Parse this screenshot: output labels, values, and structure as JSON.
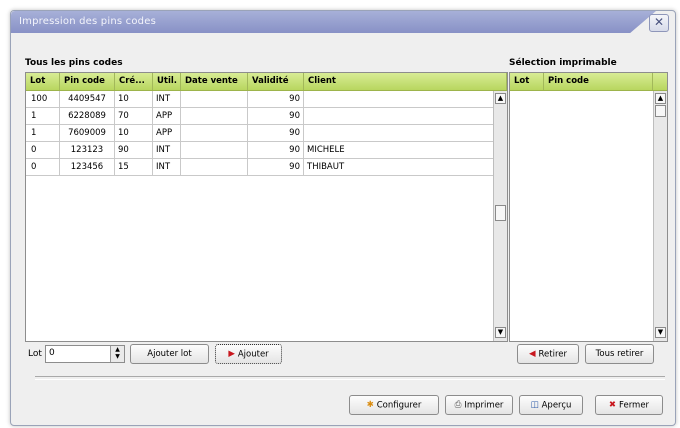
{
  "window": {
    "title": "Impression des pins codes",
    "close_glyph": "✕"
  },
  "left": {
    "label": "Tous les pins codes",
    "columns": [
      "Lot",
      "Pin code",
      "Cré...",
      "Util.",
      "Date vente",
      "Validité",
      "Client"
    ],
    "rows": [
      [
        "100",
        "4409547",
        "10",
        "INT",
        "",
        "90",
        ""
      ],
      [
        "1",
        "6228089",
        "70",
        "APP",
        "",
        "90",
        ""
      ],
      [
        "1",
        "7609009",
        "10",
        "APP",
        "",
        "90",
        ""
      ],
      [
        "0",
        "123123",
        "90",
        "INT",
        "",
        "90",
        "MICHELE"
      ],
      [
        "0",
        "123456",
        "15",
        "INT",
        "",
        "90",
        "THIBAUT"
      ]
    ]
  },
  "right": {
    "label": "Sélection imprimable",
    "columns": [
      "Lot",
      "Pin code"
    ]
  },
  "lot_control": {
    "label": "Lot",
    "value": "0"
  },
  "buttons": {
    "ajouter_lot": "Ajouter lot",
    "ajouter": "Ajouter",
    "retirer": "Retirer",
    "tous_retirer": "Tous retirer",
    "configurer": "Configurer",
    "imprimer": "Imprimer",
    "apercu": "Aperçu",
    "fermer": "Fermer"
  },
  "colors": {
    "header_green": "#c4de74",
    "title_blue": "#959dcc",
    "red_accent": "#c8171e"
  },
  "icons": [
    "close-icon",
    "arrow-left-icon",
    "arrow-right-icon",
    "configure-icon",
    "printer-icon",
    "preview-icon",
    "close-red-icon",
    "spinner-icon",
    "scroll-up-icon",
    "scroll-down-icon"
  ]
}
